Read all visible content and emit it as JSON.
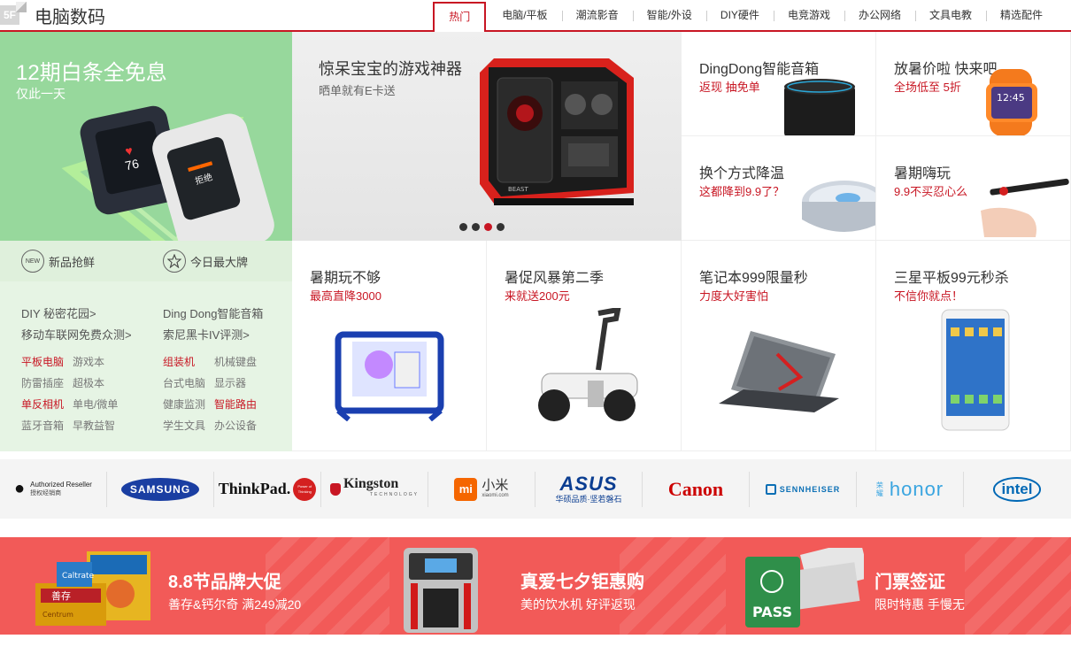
{
  "header": {
    "floor_badge": "5F",
    "title": "电脑数码",
    "tabs": [
      {
        "label": "热门",
        "active": true
      },
      {
        "label": "电脑/平板"
      },
      {
        "label": "潮流影音"
      },
      {
        "label": "智能/外设"
      },
      {
        "label": "DIY硬件"
      },
      {
        "label": "电竞游戏"
      },
      {
        "label": "办公网络"
      },
      {
        "label": "文具电教"
      },
      {
        "label": "精选配件"
      }
    ]
  },
  "left_promo": {
    "title": "12期白条全免息",
    "subtitle": "仅此一天",
    "watch_numbers": [
      "76",
      "拒绝"
    ]
  },
  "quick_links": [
    {
      "icon": "new-badge-icon",
      "icon_text": "NEW",
      "label": "新品抢鲜"
    },
    {
      "icon": "star-icon",
      "label": "今日最大牌"
    }
  ],
  "text_links": {
    "col1": [
      "DIY 秘密花园>",
      "移动车联网免费众测>"
    ],
    "col2": [
      "Ding Dong智能音箱",
      "索尼黑卡IV评测>"
    ]
  },
  "categories": {
    "col1": [
      [
        {
          "label": "平板电脑",
          "hot": true
        },
        {
          "label": "游戏本"
        }
      ],
      [
        {
          "label": "防雷插座"
        },
        {
          "label": "超极本"
        }
      ],
      [
        {
          "label": "单反相机",
          "hot": true
        },
        {
          "label": "单电/微单"
        }
      ],
      [
        {
          "label": "蓝牙音箱"
        },
        {
          "label": "早教益智"
        }
      ]
    ],
    "col2": [
      [
        {
          "label": "组装机",
          "hot": true
        },
        {
          "label": "机械键盘"
        }
      ],
      [
        {
          "label": "台式电脑"
        },
        {
          "label": "显示器"
        }
      ],
      [
        {
          "label": "健康监测"
        },
        {
          "label": "智能路由",
          "hot": true
        }
      ],
      [
        {
          "label": "学生文具"
        },
        {
          "label": "办公设备"
        }
      ]
    ]
  },
  "main_promo": {
    "title": "惊呆宝宝的游戏神器",
    "subtitle": "晒单就有E卡送",
    "case_brand": "BEAST",
    "slides": 4,
    "active_slide": 3
  },
  "top_cells": [
    {
      "title": "DingDong智能音箱",
      "subtitle": "返现 抽免单"
    },
    {
      "title": "放暑价啦 快来吧",
      "subtitle": "全场低至 5折"
    },
    {
      "title": "换个方式降温",
      "subtitle": "这都降到9.9了？"
    },
    {
      "title": "暑期嗨玩",
      "subtitle": "9.9不买忍心么"
    }
  ],
  "bottom_cells": [
    {
      "title": "暑期玩不够",
      "subtitle": "最高直降3000"
    },
    {
      "title": "暑促风暴第二季",
      "subtitle": "来就送200元"
    },
    {
      "title": "笔记本999限量秒",
      "subtitle": "力度大好害怕"
    },
    {
      "title": "三星平板99元秒杀",
      "subtitle": "不信你就点！"
    }
  ],
  "brands": [
    {
      "name": "apple",
      "text": "Authorized Reseller",
      "sub": "授权经销商"
    },
    {
      "name": "samsung",
      "text": "SAMSUNG"
    },
    {
      "name": "thinkpad",
      "text": "ThinkPad.",
      "badge": "Power of Thinking"
    },
    {
      "name": "kingston",
      "text": "Kingston",
      "sub": "TECHNOLOGY"
    },
    {
      "name": "xiaomi",
      "text": "小米",
      "sub": "xiaomi.com",
      "logo": "mi"
    },
    {
      "name": "asus",
      "text": "ASUS",
      "sub": "华硕品质·坚若磐石"
    },
    {
      "name": "canon",
      "text": "Canon"
    },
    {
      "name": "sennheiser",
      "text": "SENNHEISER"
    },
    {
      "name": "honor",
      "text": "honor",
      "prefix": "荣耀"
    },
    {
      "name": "intel",
      "text": "intel"
    }
  ],
  "banner": [
    {
      "title": "8.8节品牌大促",
      "subtitle": "善存&钙尔奇  满249减20",
      "product_labels": [
        "Caltrate",
        "善存",
        "Centrum"
      ]
    },
    {
      "title": "真爱七夕钜惠购",
      "subtitle": "美的饮水机  好评返现"
    },
    {
      "title": "门票签证",
      "subtitle": "限时特惠    手慢无",
      "product_labels": [
        "PASS"
      ]
    }
  ]
}
